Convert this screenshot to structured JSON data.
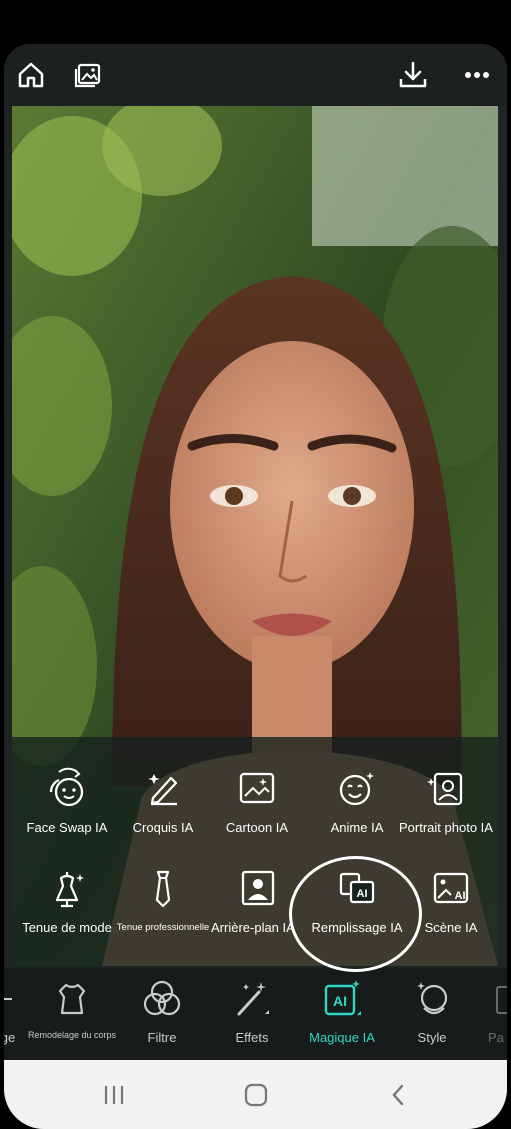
{
  "topbar": {
    "icons": [
      "home-icon",
      "gallery-icon",
      "download-icon",
      "more-icon"
    ]
  },
  "tools": [
    {
      "label": "Face Swap IA",
      "icon": "face-swap-icon"
    },
    {
      "label": "Croquis IA",
      "icon": "sketch-icon"
    },
    {
      "label": "Cartoon IA",
      "icon": "cartoon-icon"
    },
    {
      "label": "Anime IA",
      "icon": "anime-icon"
    },
    {
      "label": "Portrait photo IA",
      "icon": "portrait-icon"
    },
    {
      "label": "Tenue de mode",
      "icon": "fashion-icon"
    },
    {
      "label": "Tenue professionnelle",
      "icon": "tie-icon"
    },
    {
      "label": "Arrière-plan IA",
      "icon": "background-icon"
    },
    {
      "label": "Remplissage IA",
      "icon": "ai-fill-icon"
    },
    {
      "label": "Scène IA",
      "icon": "scene-icon"
    }
  ],
  "tabs": [
    {
      "label": "ge",
      "icon": "arrow-icon"
    },
    {
      "label": "Remodelage du corps",
      "icon": "body-icon"
    },
    {
      "label": "Filtre",
      "icon": "filter-icon"
    },
    {
      "label": "Effets",
      "icon": "wand-icon"
    },
    {
      "label": "Magique IA",
      "icon": "ai-icon",
      "active": true
    },
    {
      "label": "Style",
      "icon": "style-icon"
    },
    {
      "label": "Pa",
      "icon": "partial-icon"
    }
  ],
  "colors": {
    "accent": "#2ed8c3",
    "panel": "#16221e",
    "background": "#1f2424"
  }
}
